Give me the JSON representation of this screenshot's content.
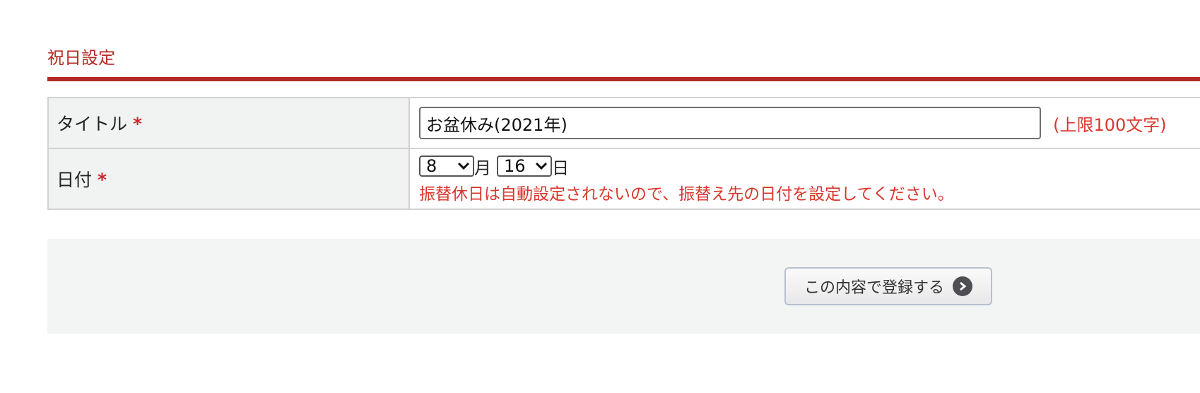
{
  "section": {
    "title": "祝日設定"
  },
  "form": {
    "title_row": {
      "label": "タイトル",
      "required_mark": "*",
      "value": "お盆休み(2021年)",
      "limit_note": "(上限100文字)"
    },
    "date_row": {
      "label": "日付",
      "required_mark": "*",
      "month_value": "8",
      "month_unit": "月",
      "day_value": "16",
      "day_unit": "日",
      "note": "振替休日は自動設定されないので、振替え先の日付を設定してください。"
    }
  },
  "footer": {
    "submit_label": "この内容で登録する"
  },
  "colors": {
    "accent": "#b52a24",
    "note_red": "#d9372c",
    "label_bg": "#f1f2f2"
  },
  "icons": {
    "submit_icon": "chevron-right-circle-icon",
    "select_icon": "chevron-down-icon"
  }
}
